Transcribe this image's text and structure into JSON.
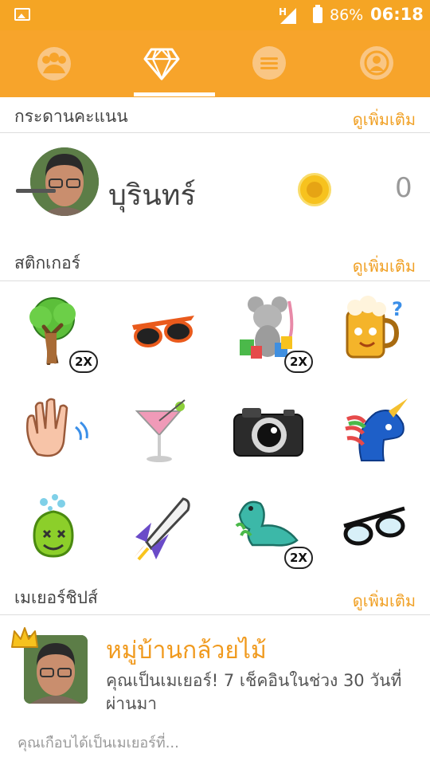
{
  "status_bar": {
    "network": "H",
    "battery_percent": "86%",
    "time": "06:18"
  },
  "tabs": [
    {
      "icon": "friends-icon",
      "active": false
    },
    {
      "icon": "diamond-icon",
      "active": true
    },
    {
      "icon": "chat-icon",
      "active": false
    },
    {
      "icon": "profile-icon",
      "active": false
    }
  ],
  "leaderboard": {
    "title": "กระดานคะแนน",
    "more": "ดูเพิ่มเติม",
    "user_name": "บุรินทร์",
    "score": "0"
  },
  "stickers": {
    "title": "สติกเกอร์",
    "more": "ดูเพิ่มเติม",
    "badge_label": "2X",
    "items": [
      {
        "icon": "tree-icon",
        "badge": "2X"
      },
      {
        "icon": "sunglasses-icon",
        "badge": ""
      },
      {
        "icon": "shopping-mouse-icon",
        "badge": "2X"
      },
      {
        "icon": "beer-mug-icon",
        "badge": ""
      },
      {
        "icon": "waving-hand-icon",
        "badge": ""
      },
      {
        "icon": "cocktail-icon",
        "badge": ""
      },
      {
        "icon": "camera-icon",
        "badge": ""
      },
      {
        "icon": "unicorn-icon",
        "badge": ""
      },
      {
        "icon": "green-blob-icon",
        "badge": ""
      },
      {
        "icon": "space-shuttle-icon",
        "badge": ""
      },
      {
        "icon": "dinosaur-icon",
        "badge": "2X"
      },
      {
        "icon": "eyeglasses-icon",
        "badge": ""
      }
    ]
  },
  "mayorships": {
    "title": "เมเยอร์ชิปส์",
    "more": "ดูเพิ่มเติม",
    "place_name": "หมู่บ้านกล้วยไม้",
    "description": "คุณเป็นเมเยอร์! 7 เช็คอินในช่วง 30 วันที่ผ่านมา",
    "footer": "คุณเกือบได้เป็นเมเยอร์ที่..."
  },
  "colors": {
    "brand_orange": "#f7a42b",
    "link_orange": "#f0a024",
    "coin_gold": "#f7c21e"
  }
}
